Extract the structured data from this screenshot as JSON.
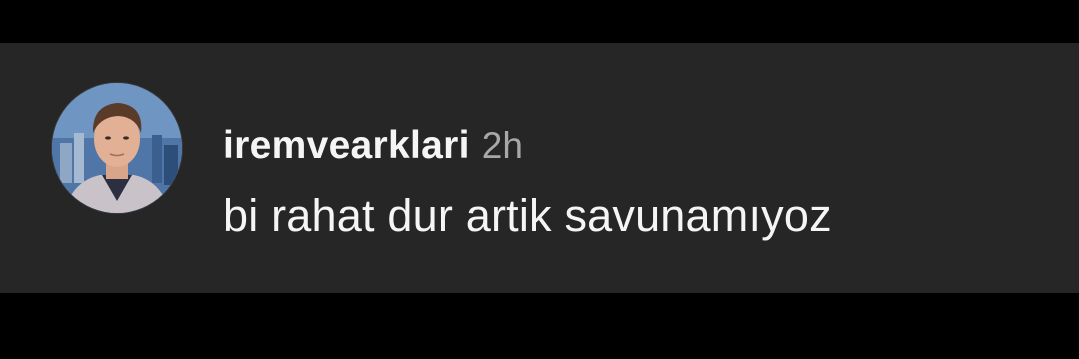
{
  "comment": {
    "username": "iremvearklari",
    "timestamp": "2h",
    "text": "bi rahat dur artik savunamıyoz",
    "avatar_icon": "profile-photo"
  },
  "colors": {
    "page_background": "#000000",
    "panel_background": "#262626",
    "username": "#f5f5f5",
    "timestamp": "#a8a8a8",
    "text": "#f5f5f5"
  }
}
